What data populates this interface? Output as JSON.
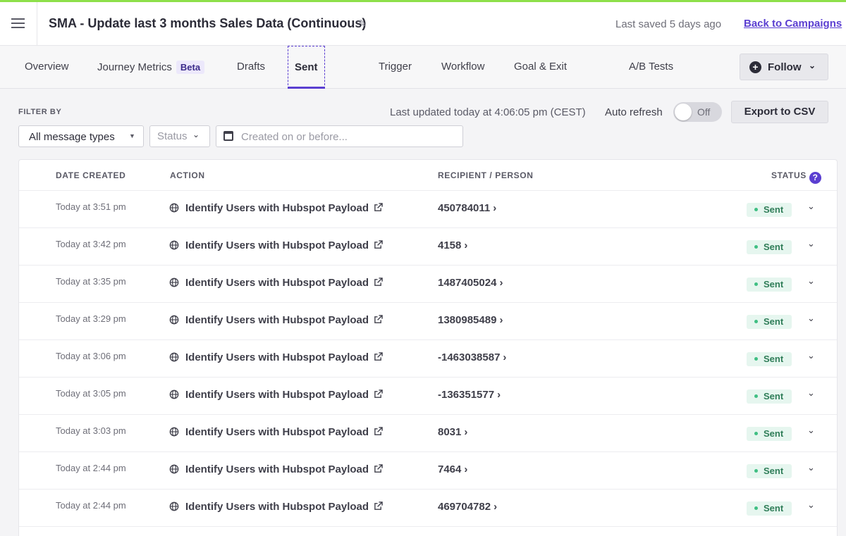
{
  "header": {
    "title": "SMA - Update last 3 months Sales Data (Continuous)",
    "saved_text": "Last saved 5 days ago",
    "back_link": "Back to Campaigns"
  },
  "tabs": [
    {
      "label": "Overview"
    },
    {
      "label": "Journey Metrics",
      "badge": "Beta"
    },
    {
      "label": "Drafts"
    },
    {
      "label": "Sent",
      "active": true
    },
    {
      "label": "Trigger"
    },
    {
      "label": "Workflow"
    },
    {
      "label": "Goal & Exit"
    },
    {
      "label": "A/B Tests"
    }
  ],
  "follow_button": "Follow",
  "filters": {
    "label": "FILTER BY",
    "message_types_value": "All message types",
    "status_placeholder": "Status",
    "date_placeholder": "Created on or before...",
    "last_updated": "Last updated today at 4:06:05 pm (CEST)",
    "auto_refresh_label": "Auto refresh",
    "toggle_state": "Off",
    "export_button": "Export to CSV"
  },
  "table": {
    "columns": {
      "date": "DATE CREATED",
      "action": "ACTION",
      "recipient": "RECIPIENT / PERSON",
      "status": "STATUS"
    },
    "rows": [
      {
        "date": "Today at 3:51 pm",
        "action": "Identify Users with Hubspot Payload",
        "recipient": "450784011",
        "status": "Sent"
      },
      {
        "date": "Today at 3:42 pm",
        "action": "Identify Users with Hubspot Payload",
        "recipient": "4158",
        "status": "Sent"
      },
      {
        "date": "Today at 3:35 pm",
        "action": "Identify Users with Hubspot Payload",
        "recipient": "1487405024",
        "status": "Sent"
      },
      {
        "date": "Today at 3:29 pm",
        "action": "Identify Users with Hubspot Payload",
        "recipient": "1380985489",
        "status": "Sent"
      },
      {
        "date": "Today at 3:06 pm",
        "action": "Identify Users with Hubspot Payload",
        "recipient": "-1463038587",
        "status": "Sent"
      },
      {
        "date": "Today at 3:05 pm",
        "action": "Identify Users with Hubspot Payload",
        "recipient": "-136351577",
        "status": "Sent"
      },
      {
        "date": "Today at 3:03 pm",
        "action": "Identify Users with Hubspot Payload",
        "recipient": "8031",
        "status": "Sent"
      },
      {
        "date": "Today at 2:44 pm",
        "action": "Identify Users with Hubspot Payload",
        "recipient": "7464",
        "status": "Sent"
      },
      {
        "date": "Today at 2:44 pm",
        "action": "Identify Users with Hubspot Payload",
        "recipient": "469704782",
        "status": "Sent"
      }
    ]
  },
  "colors": {
    "accent": "#5b3fd1",
    "top_bar": "#8ee04a",
    "status_sent_bg": "#e6f6ef",
    "status_sent_text": "#2f7d58"
  }
}
